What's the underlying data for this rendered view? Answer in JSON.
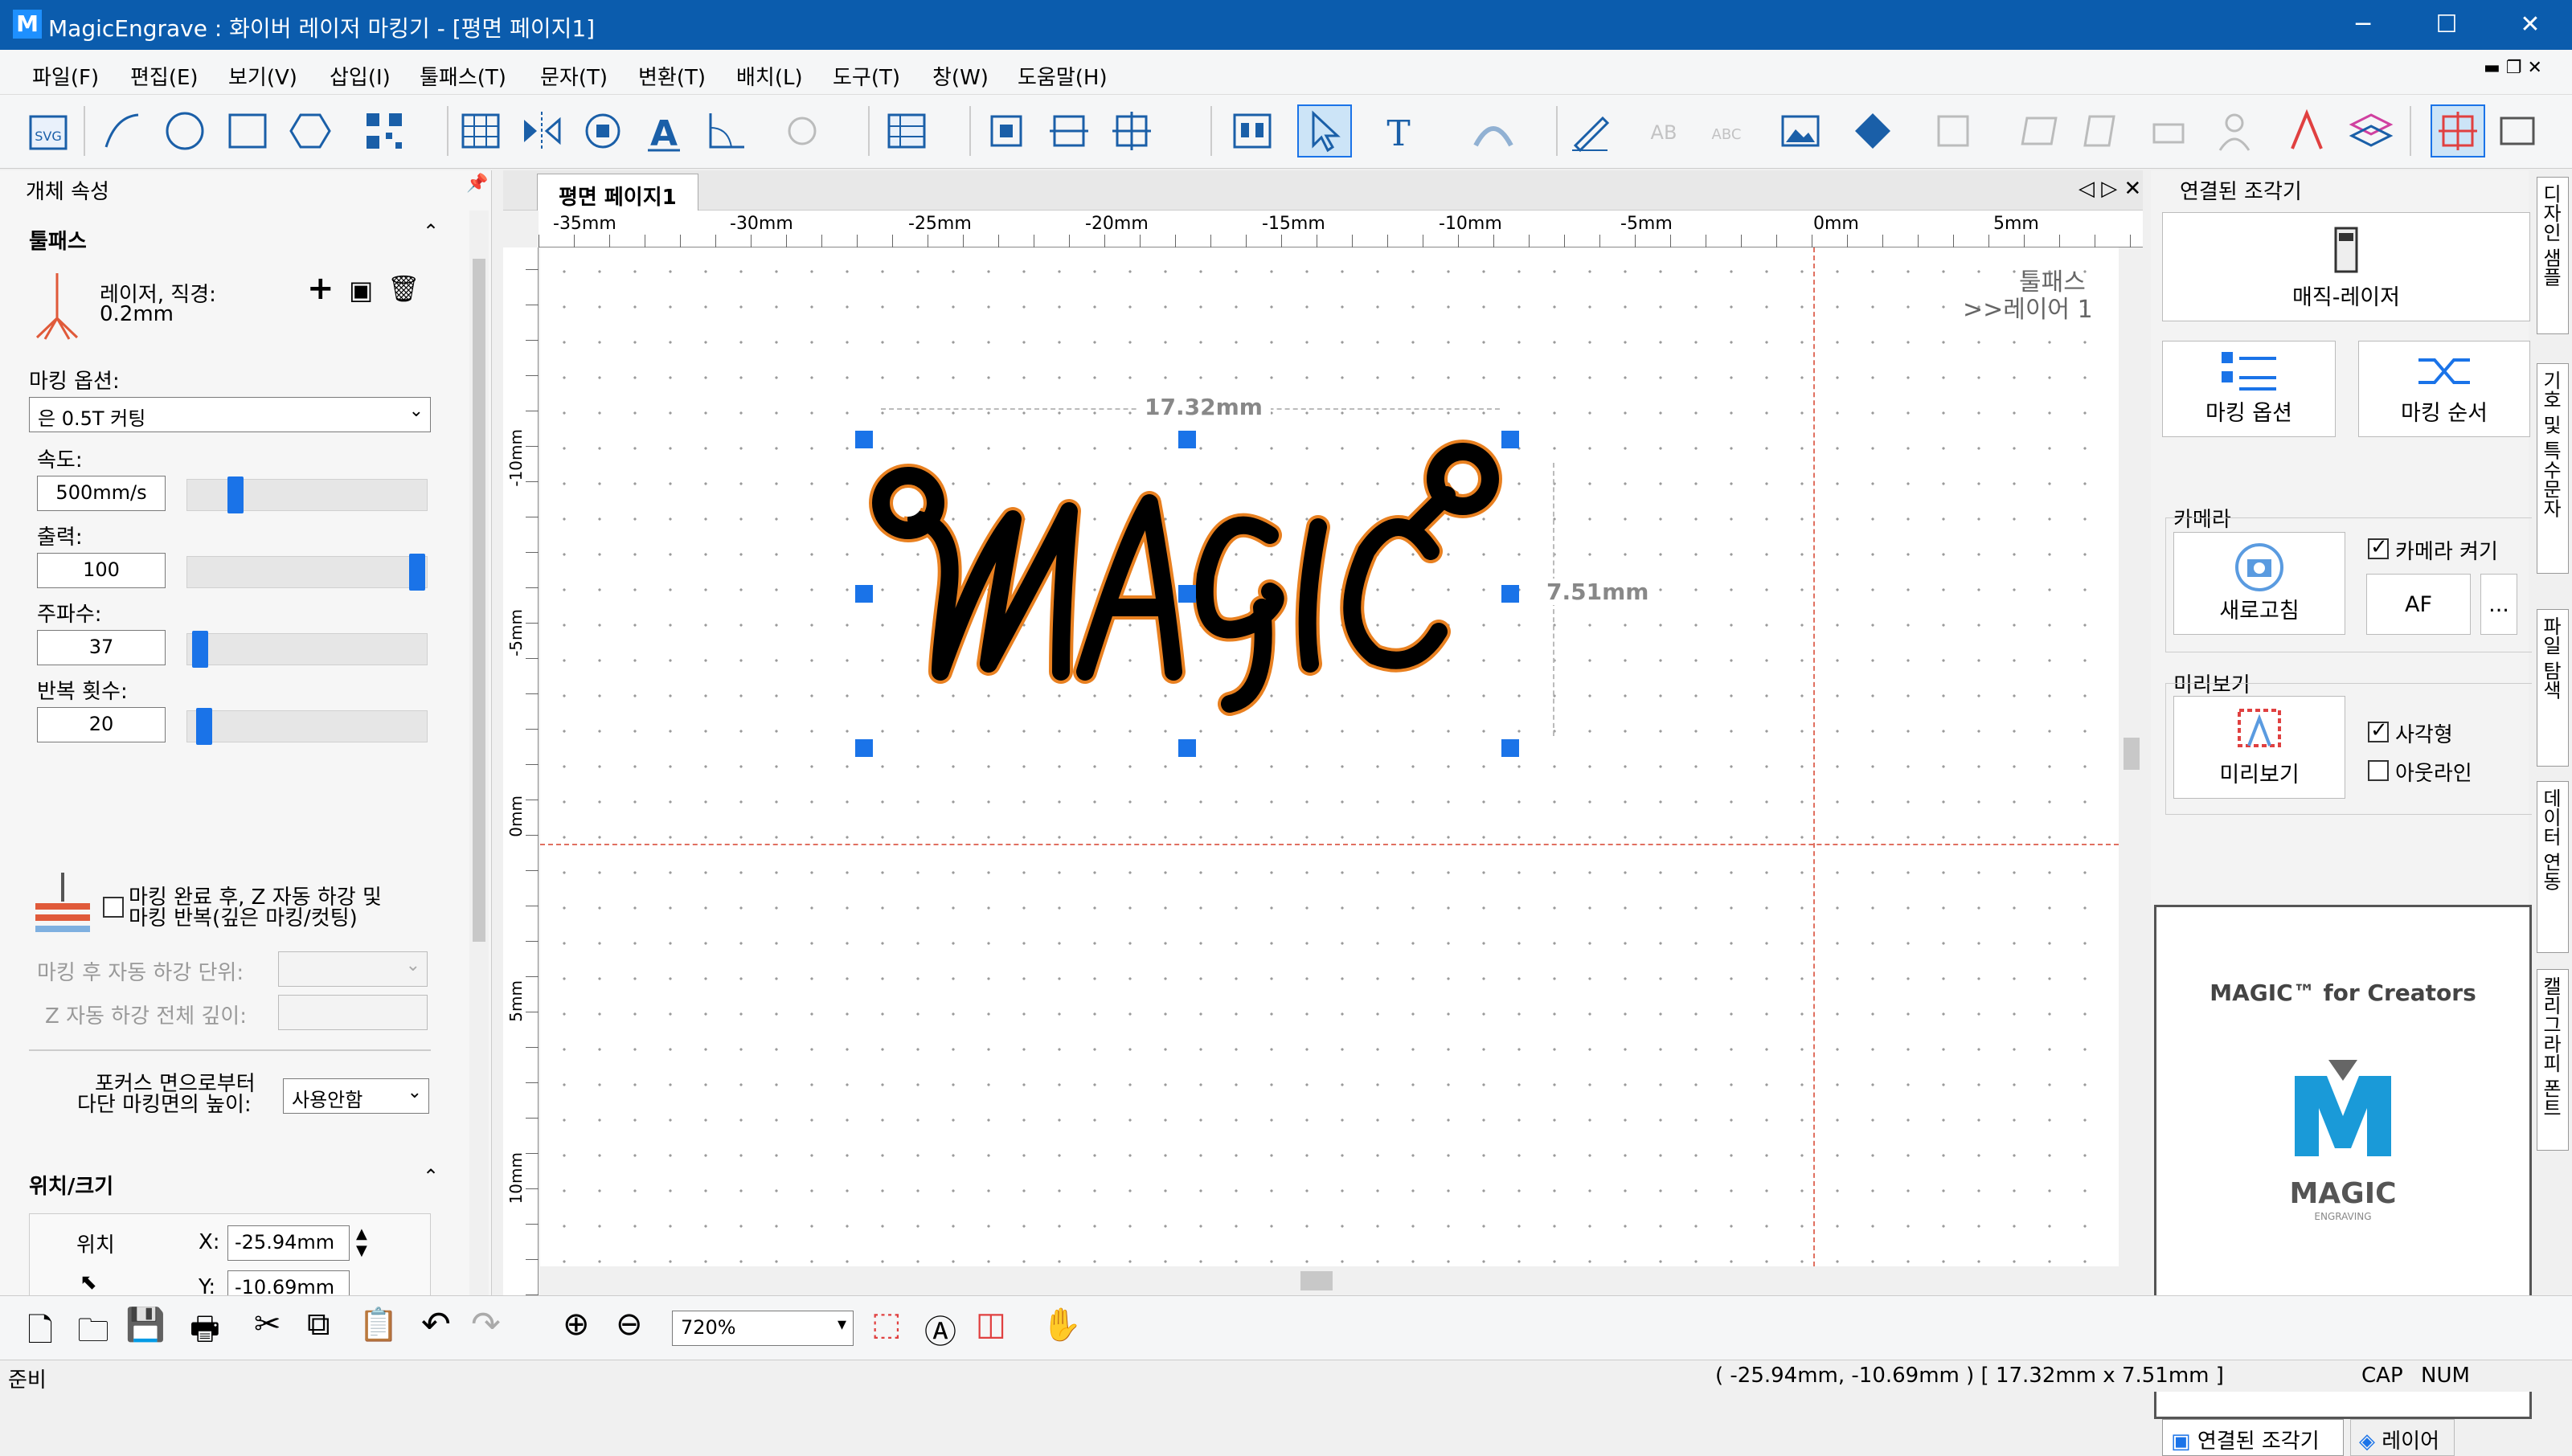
{
  "window": {
    "title": "MagicEngrave : 화이버 레이저 마킹기 - [평면  페이지1]",
    "logo": "M"
  },
  "menu": [
    "파일(F)",
    "편집(E)",
    "보기(V)",
    "삽입(I)",
    "툴패스(T)",
    "문자(T)",
    "변환(T)",
    "배치(L)",
    "도구(T)",
    "창(W)",
    "도움말(H)"
  ],
  "toolbar": {
    "svg_label": "SVG",
    "text_tool": "T",
    "ab_label": "AB",
    "abc_label": "ABC"
  },
  "left": {
    "panel_title": "개체 속성",
    "toolpath_header": "툴패스",
    "laser_line1": "레이저, 직경:",
    "laser_line2": "0.2mm",
    "marking_option_label": "마킹 옵션:",
    "marking_option_value": "은 0.5T 커팅",
    "speed_label": "속도:",
    "speed_value": "500mm/s",
    "speed_level": 0.18,
    "power_label": "출력:",
    "power_value": "100",
    "power_level": 1.0,
    "freq_label": "주파수:",
    "freq_value": "37",
    "freq_level": 0.02,
    "repeat_label": "반복 횟수:",
    "repeat_value": "20",
    "repeat_level": 0.04,
    "z_check_line1": "마킹 완료 후, Z 자동 하강 및",
    "z_check_line2": "마킹 반복(깊은 마킹/컷팅)",
    "z_unit_label": "마킹 후 자동 하강 단위:",
    "z_total_label": "Z 자동 하강 전체 깊이:",
    "focus_line1": "포커스 면으로부터",
    "focus_line2": "다단 마킹면의 높이:",
    "focus_value": "사용안함",
    "possize_header": "위치/크기",
    "position_label": "위치",
    "x_label": "X:",
    "x_value": "-25.94mm",
    "y_label": "Y:",
    "y_value": "-10.69mm"
  },
  "tab": {
    "label": "평면  페이지1"
  },
  "ruler": {
    "h_ticks": [
      "-35mm",
      "-30mm",
      "-25mm",
      "-20mm",
      "-15mm",
      "-10mm",
      "-5mm",
      "0mm",
      "5mm"
    ],
    "v_ticks": [
      "-10mm",
      "-5mm",
      "0mm",
      "5mm",
      "10mm"
    ]
  },
  "canvas": {
    "toolpath_label": "툴패스",
    "layer_label": ">>레이어 1",
    "width_dim": "17.32mm",
    "height_dim": "7.51mm",
    "artwork_text": "MAGIC"
  },
  "right": {
    "panel_title": "연결된 조각기",
    "device_label": "매직-레이저",
    "marking_option_btn": "마킹 옵션",
    "marking_order_btn": "마킹 순서",
    "camera_header": "카메라",
    "refresh_btn": "새로고침",
    "camera_on_label": "카메라 켜기",
    "camera_on": true,
    "af_btn": "AF",
    "more_btn": "...",
    "preview_header": "미리보기",
    "preview_btn": "미리보기",
    "rect_label": "사각형",
    "rect_checked": true,
    "outline_label": "아웃라인",
    "outline_checked": false,
    "ad_title": "MAGIC™ for Creators",
    "ad_logo_text": "MAGIC",
    "ad_logo_sub": "ENGRAVING",
    "bottom_tab1": "연결된 조각기",
    "bottom_tab2": "레이어"
  },
  "side_tabs": [
    "디자인 샘플",
    "기호 및 특수문자",
    "파일 탐색",
    "데이터 연동",
    "캘리그라피 폰트"
  ],
  "bottom": {
    "zoom_value": "720%"
  },
  "status": {
    "ready": "준비",
    "coords": "( -25.94mm, -10.69mm )  [ 17.32mm x 7.51mm ]",
    "cap": "CAP",
    "num": "NUM"
  },
  "colors": {
    "title_bar": "#0b5cad",
    "accent": "#1a73e8",
    "guide": "#e07060",
    "outline": "#e88020"
  }
}
